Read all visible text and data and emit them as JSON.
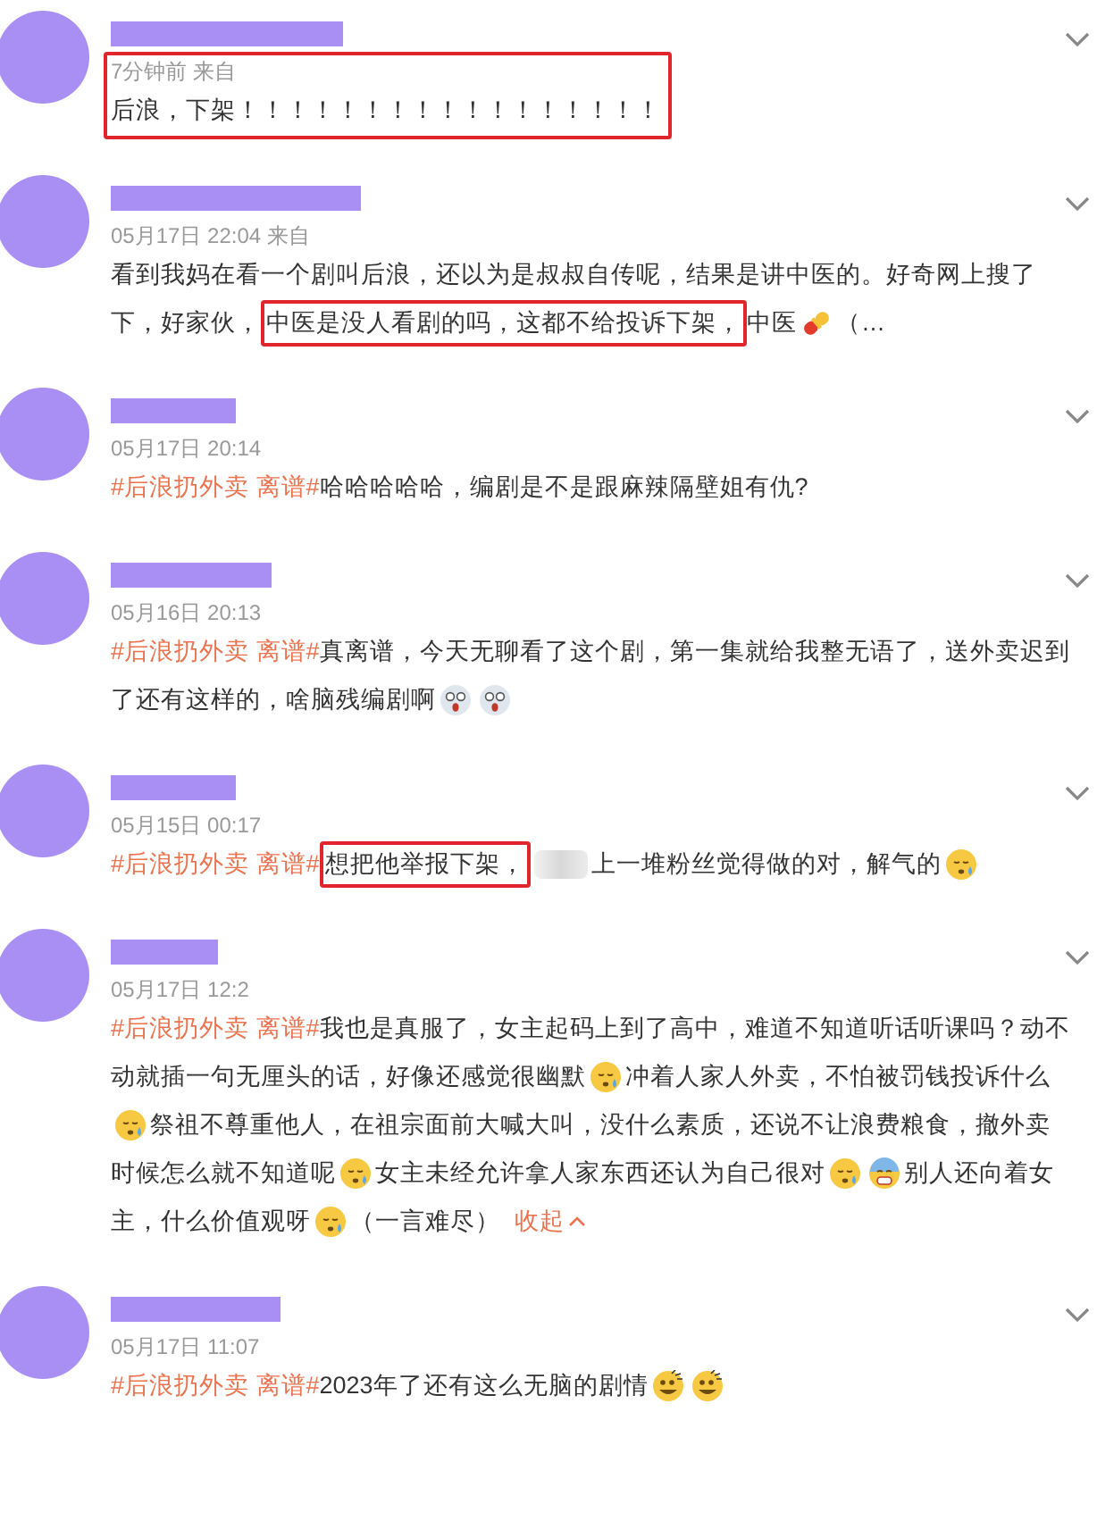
{
  "comments": [
    {
      "meta": "7分钟前 来自",
      "highlighted": true,
      "lines": [
        [
          {
            "kind": "text",
            "text": "后浪，下架！！！！！！！！！！！！！！！！！"
          }
        ]
      ]
    },
    {
      "meta": "05月17日 22:04 来自",
      "highlighted": false,
      "lines": [
        [
          {
            "kind": "text",
            "text": "看到我妈在看一个剧叫后浪，还以为是叔叔自传呢，结果是讲中医的。好奇网上搜了"
          }
        ],
        [
          {
            "kind": "text",
            "text": "下，好家伙，"
          },
          {
            "kind": "boxed",
            "text": "中医是没人看剧的吗，这都不给投诉下架，"
          },
          {
            "kind": "text",
            "text": "中医"
          },
          {
            "kind": "pill"
          },
          {
            "kind": "text",
            "text": "（…"
          }
        ]
      ]
    },
    {
      "meta": "05月17日 20:14",
      "highlighted": false,
      "lines": [
        [
          {
            "kind": "tag",
            "text": "#后浪扔外卖 离谱#"
          },
          {
            "kind": "text",
            "text": " 哈哈哈哈哈，编剧是不是跟麻辣隔壁姐有仇?"
          }
        ]
      ]
    },
    {
      "meta": "05月16日 20:13",
      "highlighted": false,
      "lines": [
        [
          {
            "kind": "tag",
            "text": "#后浪扔外卖 离谱#"
          },
          {
            "kind": "text",
            "text": "真离谱，今天无聊看了这个剧，第一集就给我整无语了，送外卖迟到"
          }
        ],
        [
          {
            "kind": "text",
            "text": "了还有这样的，啥脑残编剧啊"
          },
          {
            "kind": "shocked"
          },
          {
            "kind": "shocked"
          }
        ]
      ]
    },
    {
      "meta": "05月15日 00:17",
      "highlighted": false,
      "lines": [
        [
          {
            "kind": "tag",
            "text": "#后浪扔外卖 离谱#"
          },
          {
            "kind": "boxed",
            "text": "想把他举报下架，"
          },
          {
            "kind": "blur"
          },
          {
            "kind": "text",
            "text": "上一堆粉丝觉得做的对，解气的"
          },
          {
            "kind": "sweat"
          }
        ]
      ]
    },
    {
      "meta": "05月17日 12:2",
      "highlighted": false,
      "lines": [
        [
          {
            "kind": "tag",
            "text": "#后浪扔外卖 离谱#"
          },
          {
            "kind": "text",
            "text": "我也是真服了，女主起码上到了高中，难道不知道听话听课吗？动不"
          }
        ],
        [
          {
            "kind": "text",
            "text": "动就插一句无厘头的话，好像还感觉很幽默"
          },
          {
            "kind": "sweat"
          },
          {
            "kind": "text",
            "text": "冲着人家人外卖，不怕被罚钱投诉什么"
          }
        ],
        [
          {
            "kind": "sweat"
          },
          {
            "kind": "text",
            "text": "祭祖不尊重他人，在祖宗面前大喊大叫，没什么素质，还说不让浪费粮食，撤外卖"
          }
        ],
        [
          {
            "kind": "text",
            "text": "时候怎么就不知道呢"
          },
          {
            "kind": "sweat"
          },
          {
            "kind": "text",
            "text": "女主未经允许拿人家东西还认为自己很对"
          },
          {
            "kind": "sweat"
          },
          {
            "kind": "scream"
          },
          {
            "kind": "text",
            "text": "别人还向着女"
          }
        ],
        [
          {
            "kind": "text",
            "text": "主，什么价值观呀"
          },
          {
            "kind": "sweat"
          },
          {
            "kind": "text",
            "text": "（一言难尽）"
          },
          {
            "kind": "link",
            "text": "收起"
          }
        ]
      ]
    },
    {
      "meta": "05月17日 11:07",
      "highlighted": false,
      "lines": [
        [
          {
            "kind": "tag",
            "text": "#后浪扔外卖 离谱#"
          },
          {
            "kind": "text",
            "text": "2023年了还有这么无脑的剧情"
          },
          {
            "kind": "grin"
          },
          {
            "kind": "grin"
          }
        ]
      ]
    }
  ]
}
